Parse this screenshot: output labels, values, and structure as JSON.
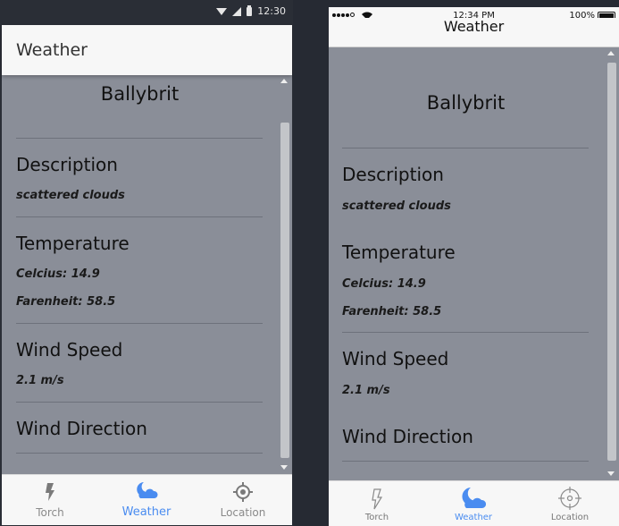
{
  "android": {
    "status_time": "12:30",
    "app_title": "Weather",
    "location": "Ballybrit",
    "sections": {
      "description_title": "Description",
      "description_value": "scattered clouds",
      "temperature_title": "Temperature",
      "celcius": "Celcius: 14.9",
      "farenheit": "Farenheit: 58.5",
      "wind_speed_title": "Wind Speed",
      "wind_speed_value": "2.1 m/s",
      "wind_direction_title": "Wind Direction"
    },
    "tabs": [
      {
        "label": "Torch",
        "icon": "torch-icon"
      },
      {
        "label": "Weather",
        "icon": "weather-icon"
      },
      {
        "label": "Location",
        "icon": "location-icon"
      }
    ],
    "active_tab": "Weather"
  },
  "ios": {
    "status_time": "12:34 PM",
    "battery": "100%",
    "app_title": "Weather",
    "location": "Ballybrit",
    "sections": {
      "description_title": "Description",
      "description_value": "scattered clouds",
      "temperature_title": "Temperature",
      "celcius": "Celcius: 14.9",
      "farenheit": "Farenheit: 58.5",
      "wind_speed_title": "Wind Speed",
      "wind_speed_value": "2.1 m/s",
      "wind_direction_title": "Wind Direction"
    },
    "tabs": [
      {
        "label": "Torch",
        "icon": "torch-icon"
      },
      {
        "label": "Weather",
        "icon": "weather-icon"
      },
      {
        "label": "Location",
        "icon": "location-icon"
      }
    ],
    "active_tab": "Weather"
  },
  "colors": {
    "background": "#262a33",
    "content": "#8a8e98",
    "bar": "#f7f7f7",
    "accent": "#4a8cf0"
  }
}
